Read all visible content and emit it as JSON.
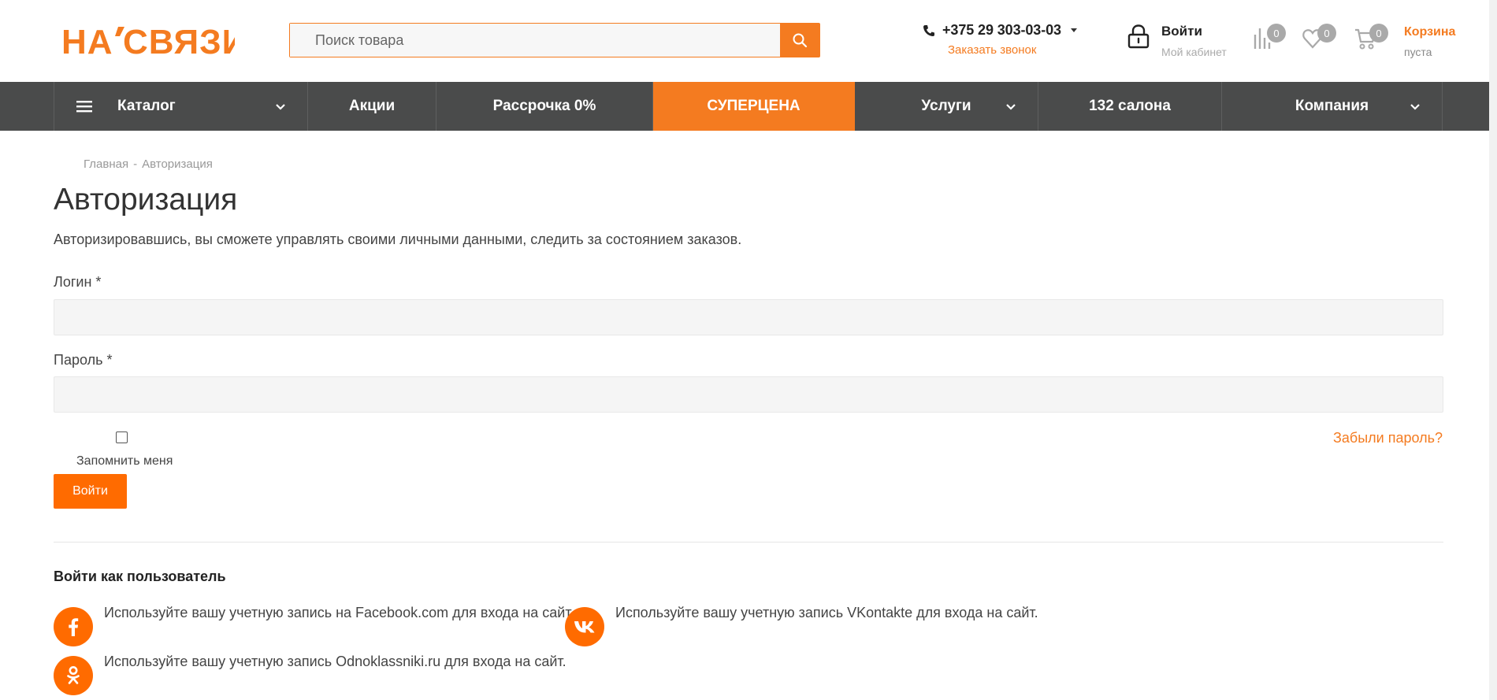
{
  "header": {
    "logo_text": "НАСВЯЗИ",
    "search_placeholder": "Поиск товара",
    "phone": "+375 29 303-03-03",
    "callback_label": "Заказать звонок",
    "login_title": "Войти",
    "login_subtitle": "Мой кабинет",
    "compare_count": "0",
    "favorites_count": "0",
    "cart_count": "0",
    "cart_title": "Корзина",
    "cart_status": "пуста",
    "accent_color": "#f47b20"
  },
  "nav": {
    "items": [
      {
        "label": "Каталог"
      },
      {
        "label": "Акции"
      },
      {
        "label": "Рассрочка 0%"
      },
      {
        "label": "СУПЕРЦЕНА"
      },
      {
        "label": "Услуги"
      },
      {
        "label": "132 салона"
      },
      {
        "label": "Компания"
      }
    ]
  },
  "breadcrumb": {
    "home": "Главная",
    "separator": "-",
    "current": "Авторизация"
  },
  "page": {
    "title": "Авторизация",
    "subtitle": "Авторизировавшись, вы сможете управлять своими личными данными, следить за состоянием заказов."
  },
  "form": {
    "login_label": "Логин *",
    "login_value": "",
    "password_label": "Пароль *",
    "password_value": "",
    "remember_label": "Запомнить меня",
    "forgot_label": "Забыли пароль?",
    "submit_label": "Войти"
  },
  "social": {
    "title": "Войти как пользователь",
    "facebook_text": "Используйте вашу учетную запись на Facebook.com для входа на сайт.",
    "vk_text": "Используйте вашу учетную запись VKontakte для входа на сайт.",
    "ok_text": "Используйте вашу учетную запись Odnoklassniki.ru для входа на сайт."
  }
}
